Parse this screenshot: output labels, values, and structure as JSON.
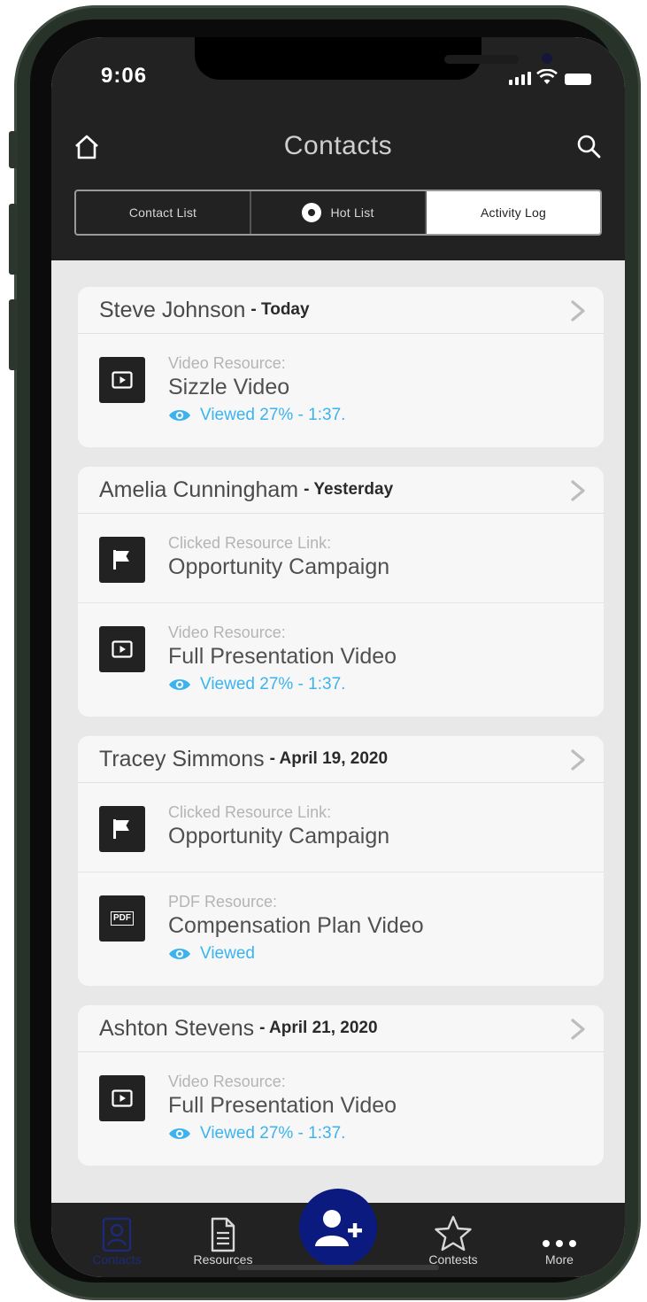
{
  "status_bar": {
    "time": "9:06"
  },
  "header": {
    "title": "Contacts",
    "tabs": [
      {
        "label": "Contact List",
        "active": false
      },
      {
        "label": "Hot List",
        "active": false
      },
      {
        "label": "Activity Log",
        "active": true
      }
    ]
  },
  "activity": [
    {
      "name": "Steve Johnson",
      "date": "- Today",
      "items": [
        {
          "type": "Video Resource:",
          "resource": "Sizzle Video",
          "status": "Viewed 27% - 1:37.",
          "icon": "video-icon"
        }
      ]
    },
    {
      "name": "Amelia Cunningham",
      "date": "- Yesterday",
      "items": [
        {
          "type": "Clicked Resource Link:",
          "resource": "Opportunity Campaign",
          "status": "",
          "icon": "flag-icon"
        },
        {
          "type": "Video Resource:",
          "resource": "Full Presentation Video",
          "status": "Viewed 27% - 1:37.",
          "icon": "video-icon"
        }
      ]
    },
    {
      "name": "Tracey Simmons",
      "date": "- April 19, 2020",
      "items": [
        {
          "type": "Clicked Resource Link:",
          "resource": "Opportunity Campaign",
          "status": "",
          "icon": "flag-icon"
        },
        {
          "type": "PDF Resource:",
          "resource": "Compensation Plan Video",
          "status": "Viewed",
          "icon": "pdf-icon"
        }
      ]
    },
    {
      "name": "Ashton Stevens",
      "date": "- April 21, 2020",
      "items": [
        {
          "type": "Video Resource:",
          "resource": "Full Presentation Video",
          "status": "Viewed 27% - 1:37.",
          "icon": "video-icon"
        }
      ]
    }
  ],
  "pdf_icon_label": "PDF",
  "tabbar": {
    "items": [
      {
        "label": "Contacts",
        "icon": "contacts-icon",
        "active": true
      },
      {
        "label": "Resources",
        "icon": "document-icon",
        "active": false
      },
      {
        "label": "Contests",
        "icon": "star-icon",
        "active": false
      },
      {
        "label": "More",
        "icon": "more-icon",
        "active": false
      }
    ],
    "fab_icon": "add-contact-icon"
  },
  "colors": {
    "header_bg": "#222222",
    "accent_blue": "#3bb3ee",
    "fab_blue": "#0a1a7e",
    "content_bg": "#e8e8e8",
    "card_bg": "#f7f7f7"
  }
}
